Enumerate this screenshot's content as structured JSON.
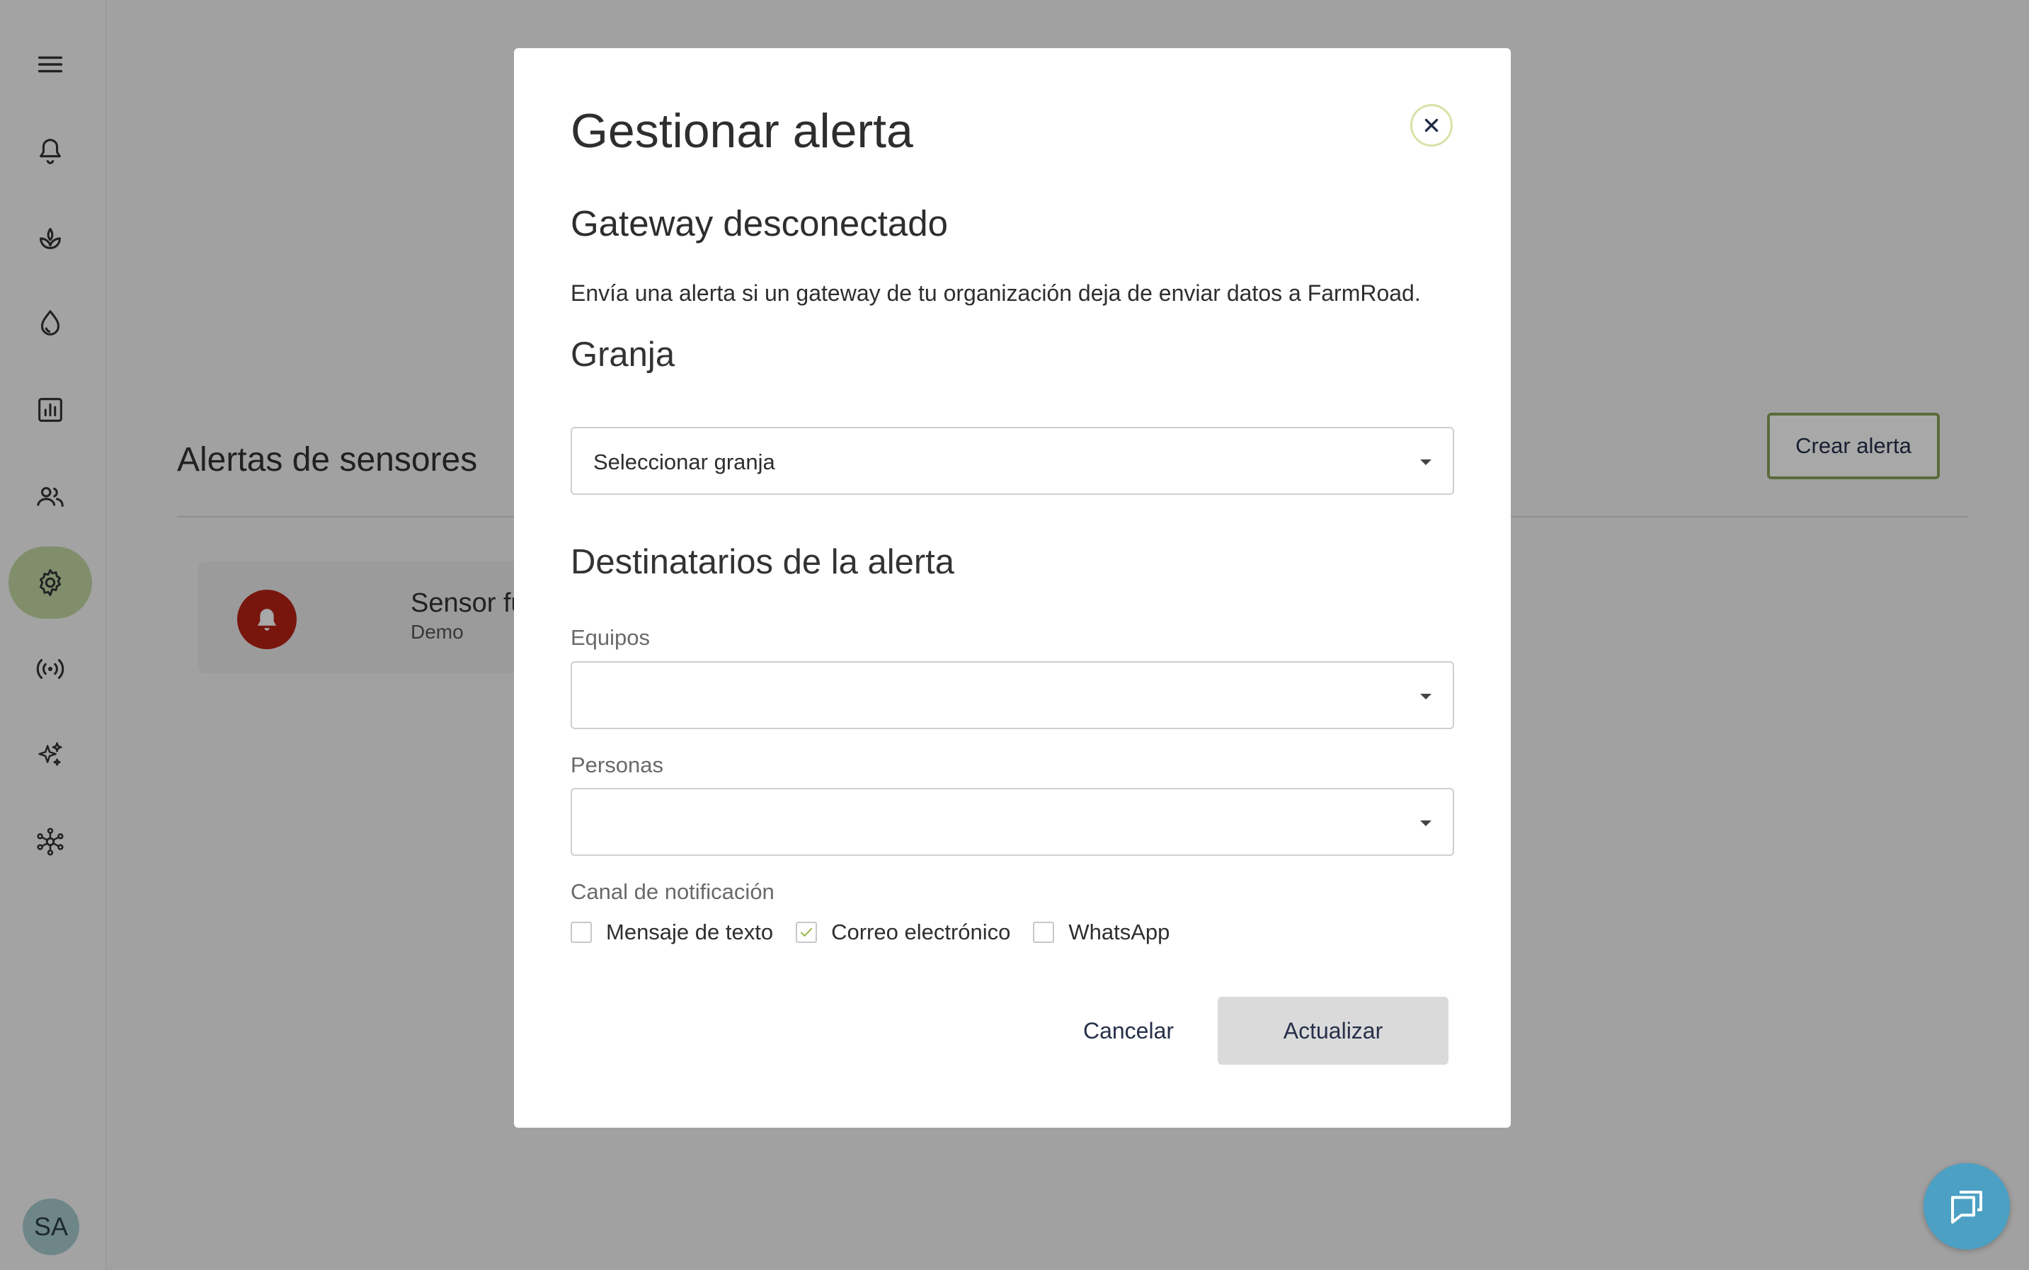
{
  "sidebar": {
    "items": [
      {
        "icon": "menu-icon"
      },
      {
        "icon": "bell-icon"
      },
      {
        "icon": "sprout-icon"
      },
      {
        "icon": "water-drop-icon"
      },
      {
        "icon": "bar-chart-icon"
      },
      {
        "icon": "people-icon"
      },
      {
        "icon": "gear-icon",
        "active": true
      },
      {
        "icon": "broadcast-icon"
      },
      {
        "icon": "sparkles-icon"
      },
      {
        "icon": "network-icon"
      }
    ],
    "avatar_initials": "SA"
  },
  "page": {
    "title": "Alertas de sensores",
    "create_button": "Crear alerta",
    "alert_card": {
      "name": "Sensor fuera de",
      "farm": "Demo"
    }
  },
  "modal": {
    "title": "Gestionar alerta",
    "alert_name": "Gateway desconectado",
    "description": "Envía una alerta si un gateway de tu organización deja de enviar datos a FarmRoad.",
    "farm_section": "Granja",
    "farm_select_value": "Seleccionar granja",
    "recipients_section": "Destinatarios de la alerta",
    "teams_label": "Equipos",
    "teams_value": "",
    "people_label": "Personas",
    "people_value": "",
    "channel_label": "Canal de notificación",
    "channels": [
      {
        "label": "Mensaje de texto",
        "checked": false
      },
      {
        "label": "Correo electrónico",
        "checked": true
      },
      {
        "label": "WhatsApp",
        "checked": false
      }
    ],
    "cancel_label": "Cancelar",
    "update_label": "Actualizar"
  },
  "colors": {
    "active_nav": "#c3d8a5",
    "accent_green": "#8aa35a",
    "alert_red": "#b62216",
    "chat_blue": "#4ba0c4"
  }
}
